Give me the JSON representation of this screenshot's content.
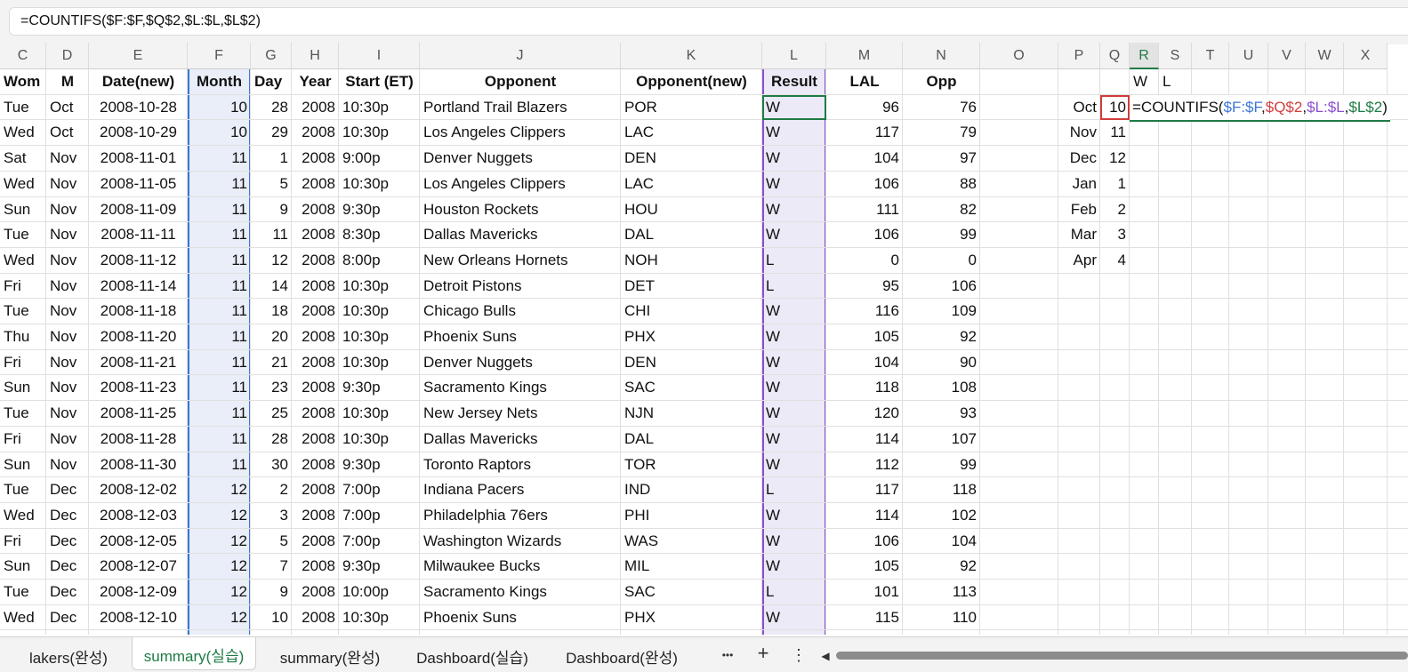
{
  "formula_bar": {
    "formula": "=COUNTIFS($F:$F,$Q$2,$L:$L,$L$2)"
  },
  "columns": [
    "C",
    "D",
    "E",
    "F",
    "G",
    "H",
    "I",
    "J",
    "K",
    "L",
    "M",
    "N",
    "O",
    "P",
    "Q",
    "R",
    "S",
    "T",
    "U",
    "V",
    "W",
    "X"
  ],
  "selected_column": "R",
  "table_headers": [
    "Wom",
    "M",
    "Date(new)",
    "Month",
    "Day",
    "Year",
    "Start (ET)",
    "Opponent",
    "Opponent(new)",
    "Result",
    "LAL",
    "Opp"
  ],
  "rows": [
    [
      "Tue",
      "Oct",
      "2008-10-28",
      "10",
      "28",
      "2008",
      "10:30p",
      "Portland Trail Blazers",
      "POR",
      "W",
      "96",
      "76"
    ],
    [
      "Wed",
      "Oct",
      "2008-10-29",
      "10",
      "29",
      "2008",
      "10:30p",
      "Los Angeles Clippers",
      "LAC",
      "W",
      "117",
      "79"
    ],
    [
      "Sat",
      "Nov",
      "2008-11-01",
      "11",
      "1",
      "2008",
      "9:00p",
      "Denver Nuggets",
      "DEN",
      "W",
      "104",
      "97"
    ],
    [
      "Wed",
      "Nov",
      "2008-11-05",
      "11",
      "5",
      "2008",
      "10:30p",
      "Los Angeles Clippers",
      "LAC",
      "W",
      "106",
      "88"
    ],
    [
      "Sun",
      "Nov",
      "2008-11-09",
      "11",
      "9",
      "2008",
      "9:30p",
      "Houston Rockets",
      "HOU",
      "W",
      "111",
      "82"
    ],
    [
      "Tue",
      "Nov",
      "2008-11-11",
      "11",
      "11",
      "2008",
      "8:30p",
      "Dallas Mavericks",
      "DAL",
      "W",
      "106",
      "99"
    ],
    [
      "Wed",
      "Nov",
      "2008-11-12",
      "11",
      "12",
      "2008",
      "8:00p",
      "New Orleans Hornets",
      "NOH",
      "L",
      "0",
      "0"
    ],
    [
      "Fri",
      "Nov",
      "2008-11-14",
      "11",
      "14",
      "2008",
      "10:30p",
      "Detroit Pistons",
      "DET",
      "L",
      "95",
      "106"
    ],
    [
      "Tue",
      "Nov",
      "2008-11-18",
      "11",
      "18",
      "2008",
      "10:30p",
      "Chicago Bulls",
      "CHI",
      "W",
      "116",
      "109"
    ],
    [
      "Thu",
      "Nov",
      "2008-11-20",
      "11",
      "20",
      "2008",
      "10:30p",
      "Phoenix Suns",
      "PHX",
      "W",
      "105",
      "92"
    ],
    [
      "Fri",
      "Nov",
      "2008-11-21",
      "11",
      "21",
      "2008",
      "10:30p",
      "Denver Nuggets",
      "DEN",
      "W",
      "104",
      "90"
    ],
    [
      "Sun",
      "Nov",
      "2008-11-23",
      "11",
      "23",
      "2008",
      "9:30p",
      "Sacramento Kings",
      "SAC",
      "W",
      "118",
      "108"
    ],
    [
      "Tue",
      "Nov",
      "2008-11-25",
      "11",
      "25",
      "2008",
      "10:30p",
      "New Jersey Nets",
      "NJN",
      "W",
      "120",
      "93"
    ],
    [
      "Fri",
      "Nov",
      "2008-11-28",
      "11",
      "28",
      "2008",
      "10:30p",
      "Dallas Mavericks",
      "DAL",
      "W",
      "114",
      "107"
    ],
    [
      "Sun",
      "Nov",
      "2008-11-30",
      "11",
      "30",
      "2008",
      "9:30p",
      "Toronto Raptors",
      "TOR",
      "W",
      "112",
      "99"
    ],
    [
      "Tue",
      "Dec",
      "2008-12-02",
      "12",
      "2",
      "2008",
      "7:00p",
      "Indiana Pacers",
      "IND",
      "L",
      "117",
      "118"
    ],
    [
      "Wed",
      "Dec",
      "2008-12-03",
      "12",
      "3",
      "2008",
      "7:00p",
      "Philadelphia 76ers",
      "PHI",
      "W",
      "114",
      "102"
    ],
    [
      "Fri",
      "Dec",
      "2008-12-05",
      "12",
      "5",
      "2008",
      "7:00p",
      "Washington Wizards",
      "WAS",
      "W",
      "106",
      "104"
    ],
    [
      "Sun",
      "Dec",
      "2008-12-07",
      "12",
      "7",
      "2008",
      "9:30p",
      "Milwaukee Bucks",
      "MIL",
      "W",
      "105",
      "92"
    ],
    [
      "Tue",
      "Dec",
      "2008-12-09",
      "12",
      "9",
      "2008",
      "10:00p",
      "Sacramento Kings",
      "SAC",
      "L",
      "101",
      "113"
    ],
    [
      "Wed",
      "Dec",
      "2008-12-10",
      "12",
      "10",
      "2008",
      "10:30p",
      "Phoenix Suns",
      "PHX",
      "W",
      "115",
      "110"
    ]
  ],
  "summary": {
    "header_w": "W",
    "header_l": "L",
    "months": [
      {
        "name": "Oct",
        "num": "10"
      },
      {
        "name": "Nov",
        "num": "11"
      },
      {
        "name": "Dec",
        "num": "12"
      },
      {
        "name": "Jan",
        "num": "1"
      },
      {
        "name": "Feb",
        "num": "2"
      },
      {
        "name": "Mar",
        "num": "3"
      },
      {
        "name": "Apr",
        "num": "4"
      }
    ],
    "edit_formula": {
      "prefix": "=COUNTIFS(",
      "ref1": "$F:$F",
      "ref2": "$Q$2",
      "ref3": "$L:$L",
      "ref4": "$L$2",
      "suffix": ")",
      "sep": ","
    }
  },
  "sheet_tabs": [
    "lakers(완성)",
    "summary(실습)",
    "summary(완성)",
    "Dashboard(실습)",
    "Dashboard(완성)"
  ],
  "active_tab": "summary(실습)",
  "tab_controls": {
    "more": "•••",
    "add": "+",
    "menu": "⋮",
    "scroll_left": "◀"
  },
  "colors": {
    "month_highlight": "#e9eef8",
    "result_highlight": "#eceaf7",
    "month_border": "#3a77d6",
    "result_border": "#8a4fcf",
    "q_ref": "#d23c3c",
    "active_green": "#1e7b45"
  }
}
